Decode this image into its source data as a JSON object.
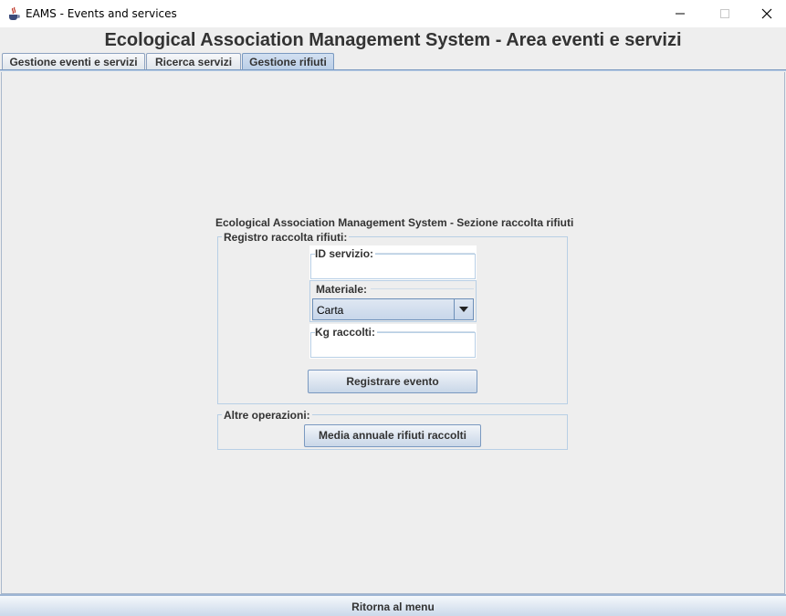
{
  "window": {
    "title": "EAMS - Events and services",
    "icon": "java-cup-icon"
  },
  "header": {
    "title": "Ecological Association Management System - Area eventi e servizi"
  },
  "tabs": [
    {
      "label": "Gestione eventi e servizi",
      "selected": false
    },
    {
      "label": "Ricerca servizi",
      "selected": false
    },
    {
      "label": "Gestione rifiuti",
      "selected": true
    }
  ],
  "section": {
    "title": "Ecological Association Management System - Sezione raccolta rifiuti"
  },
  "registro": {
    "label": "Registro raccolta rifiuti:",
    "id_servizio": {
      "label": "ID servizio:",
      "value": ""
    },
    "materiale": {
      "label": "Materiale:",
      "selected": "Carta"
    },
    "kg_raccolti": {
      "label": "Kg raccolti:",
      "value": ""
    },
    "register_button": "Registrare evento"
  },
  "altre": {
    "label": "Altre operazioni:",
    "media_button": "Media annuale rifiuti raccolti"
  },
  "footer": {
    "back_button": "Ritorna al menu"
  },
  "colors": {
    "accent_border": "#7a99c0",
    "group_border": "#b8cfe5",
    "background": "#eeeeee"
  }
}
